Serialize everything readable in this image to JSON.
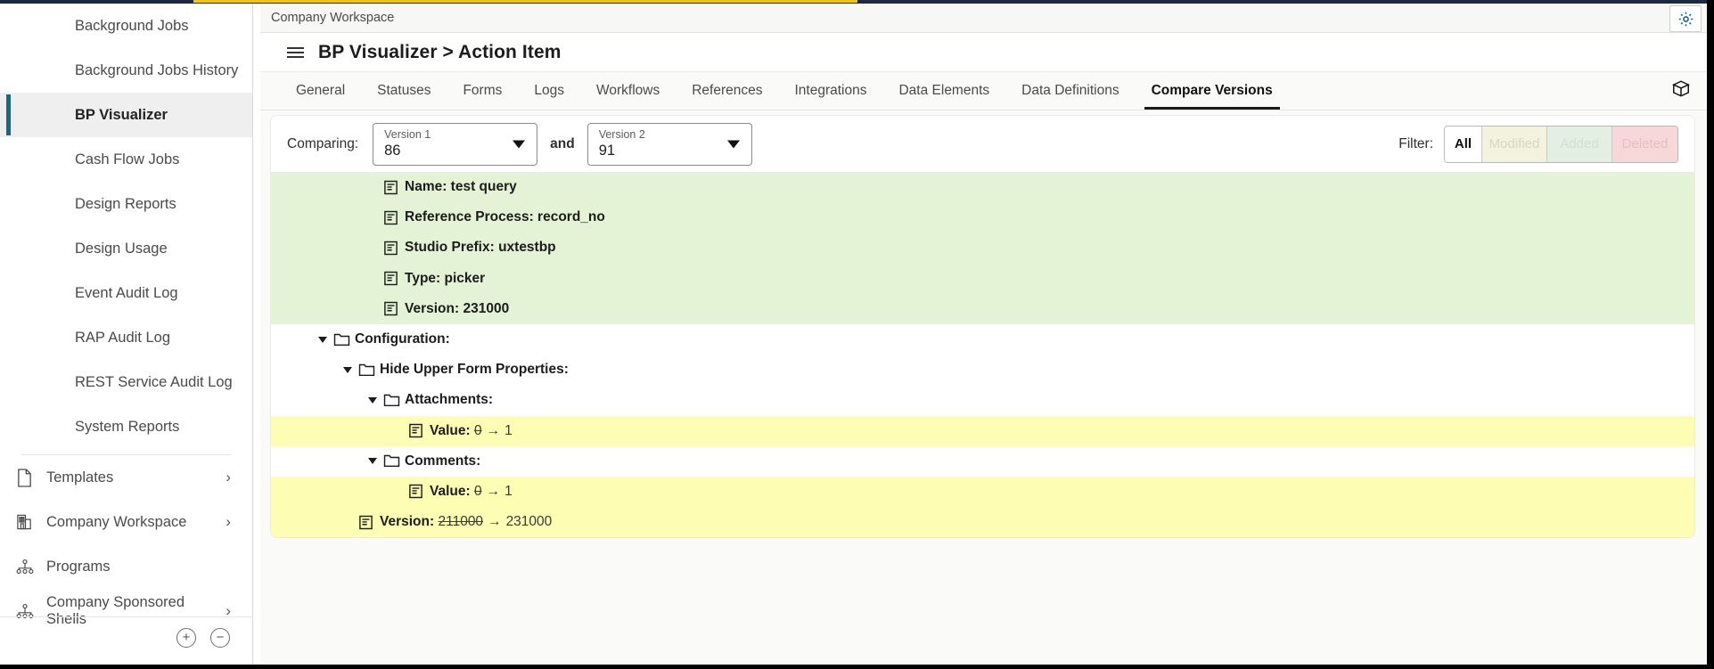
{
  "colors": {
    "accent": "#126a87",
    "added_bg": "#e4f2d6",
    "modified_bg": "#fdfdb4",
    "deleted_bg": "#f6d8d8",
    "topbar_dark": "#1b2a41",
    "topbar_yellow": "#f0c419"
  },
  "sidebar": {
    "items": [
      {
        "label": "Background Jobs",
        "active": false
      },
      {
        "label": "Background Jobs History",
        "active": false
      },
      {
        "label": "BP Visualizer",
        "active": true
      },
      {
        "label": "Cash Flow Jobs",
        "active": false
      },
      {
        "label": "Design Reports",
        "active": false
      },
      {
        "label": "Design Usage",
        "active": false
      },
      {
        "label": "Event Audit Log",
        "active": false
      },
      {
        "label": "RAP Audit Log",
        "active": false
      },
      {
        "label": "REST Service Audit Log",
        "active": false
      },
      {
        "label": "System Reports",
        "active": false
      }
    ],
    "groups": [
      {
        "label": "Templates",
        "icon": "document-icon",
        "chevron": "›"
      },
      {
        "label": "Company Workspace",
        "icon": "building-icon",
        "chevron": "›"
      },
      {
        "label": "Programs",
        "icon": "hierarchy-icon",
        "chevron": ""
      },
      {
        "label": "Company Sponsored Shells",
        "icon": "hierarchy-icon",
        "chevron": "›"
      }
    ],
    "footer": {
      "expand_all": "+",
      "collapse_all": "−"
    }
  },
  "header": {
    "breadcrumb": "Company Workspace",
    "title": "BP Visualizer > Action Item",
    "gear_icon": "gear-icon",
    "menu_icon": "hamburger-icon",
    "box_icon": "package-icon"
  },
  "tabs": [
    {
      "label": "General",
      "active": false
    },
    {
      "label": "Statuses",
      "active": false
    },
    {
      "label": "Forms",
      "active": false
    },
    {
      "label": "Logs",
      "active": false
    },
    {
      "label": "Workflows",
      "active": false
    },
    {
      "label": "References",
      "active": false
    },
    {
      "label": "Integrations",
      "active": false
    },
    {
      "label": "Data Elements",
      "active": false
    },
    {
      "label": "Data Definitions",
      "active": false
    },
    {
      "label": "Compare Versions",
      "active": true
    }
  ],
  "controls": {
    "comparing_label": "Comparing:",
    "version1": {
      "label": "Version 1",
      "value": "86"
    },
    "and_label": "and",
    "version2": {
      "label": "Version 2",
      "value": "91"
    },
    "filter_label": "Filter:",
    "filters": [
      {
        "label": "All",
        "state": "selected"
      },
      {
        "label": "Modified",
        "state": "disabled"
      },
      {
        "label": "Added",
        "state": "disabled"
      },
      {
        "label": "Deleted",
        "state": "disabled"
      }
    ]
  },
  "tree": [
    {
      "indent": 3,
      "caret": false,
      "icon": "file-text-icon",
      "label": "Name: test query",
      "status": "added"
    },
    {
      "indent": 3,
      "caret": false,
      "icon": "file-text-icon",
      "label": "Reference Process: record_no",
      "status": "added"
    },
    {
      "indent": 3,
      "caret": false,
      "icon": "file-text-icon",
      "label": "Studio Prefix: uxtestbp",
      "status": "added"
    },
    {
      "indent": 3,
      "caret": false,
      "icon": "file-text-icon",
      "label": "Type: picker",
      "status": "added"
    },
    {
      "indent": 3,
      "caret": false,
      "icon": "file-text-icon",
      "label": "Version: 231000",
      "status": "added"
    },
    {
      "indent": 1,
      "caret": true,
      "icon": "folder-icon",
      "label": "Configuration:",
      "status": "none"
    },
    {
      "indent": 2,
      "caret": true,
      "icon": "folder-icon",
      "label": "Hide Upper Form Properties:",
      "status": "none"
    },
    {
      "indent": 3,
      "caret": true,
      "icon": "folder-icon",
      "label": "Attachments:",
      "status": "none"
    },
    {
      "indent": 4,
      "caret": false,
      "icon": "file-text-icon",
      "label": "Value:",
      "old": "0",
      "new": "1",
      "status": "modified"
    },
    {
      "indent": 3,
      "caret": true,
      "icon": "folder-icon",
      "label": "Comments:",
      "status": "none"
    },
    {
      "indent": 4,
      "caret": false,
      "icon": "file-text-icon",
      "label": "Value:",
      "old": "0",
      "new": "1",
      "status": "modified"
    },
    {
      "indent": 2,
      "caret": false,
      "icon": "file-text-icon",
      "label": "Version:",
      "old": "211000",
      "new": "231000",
      "status": "modified"
    }
  ]
}
